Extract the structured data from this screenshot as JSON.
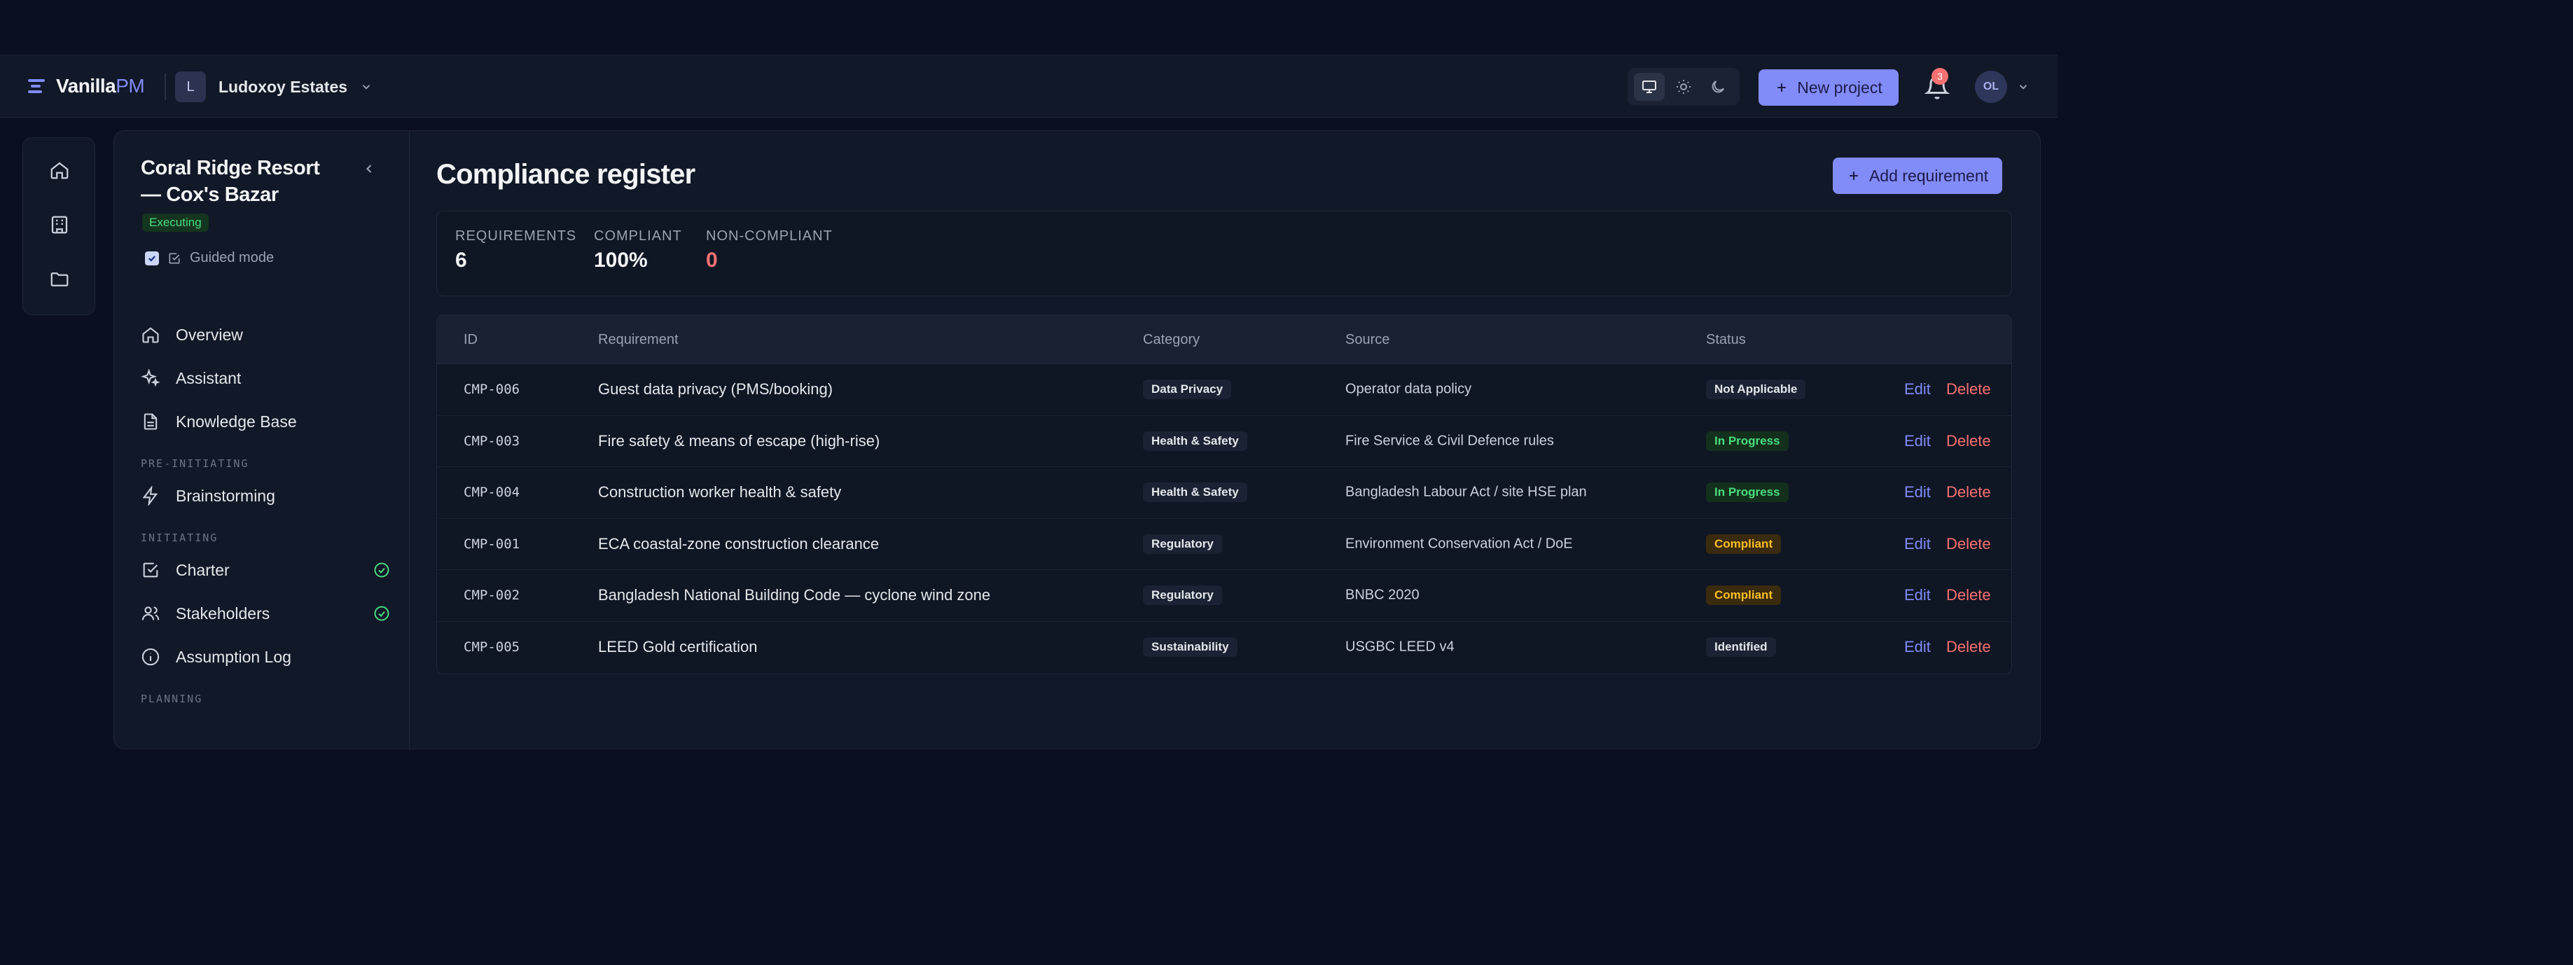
{
  "topbar": {
    "brand": {
      "name": "Vanilla",
      "suffix": "PM"
    },
    "org": {
      "initial": "L",
      "name": "Ludoxoy Estates"
    },
    "new_project_label": "New project",
    "notifications_count": "3",
    "user_initials": "OL"
  },
  "sidebar": {
    "project_title": "Coral Ridge Resort — Cox's Bazar",
    "status": "Executing",
    "guided_mode_label": "Guided mode",
    "items": [
      {
        "label": "Overview",
        "icon": "home-icon"
      },
      {
        "label": "Assistant",
        "icon": "sparkle-icon"
      },
      {
        "label": "Knowledge Base",
        "icon": "document-icon"
      }
    ],
    "sections": [
      {
        "title": "PRE-INITIATING",
        "items": [
          {
            "label": "Brainstorming",
            "icon": "bolt-icon"
          }
        ]
      },
      {
        "title": "INITIATING",
        "items": [
          {
            "label": "Charter",
            "icon": "checkbox-icon",
            "done": true
          },
          {
            "label": "Stakeholders",
            "icon": "users-icon",
            "done": true
          },
          {
            "label": "Assumption Log",
            "icon": "info-icon"
          }
        ]
      },
      {
        "title": "PLANNING",
        "items": []
      }
    ]
  },
  "main": {
    "title": "Compliance register",
    "add_button_label": "Add requirement",
    "stats": [
      {
        "label": "REQUIREMENTS",
        "value": "6"
      },
      {
        "label": "COMPLIANT",
        "value": "100%"
      },
      {
        "label": "NON-COMPLIANT",
        "value": "0"
      }
    ],
    "table": {
      "columns": [
        "ID",
        "Requirement",
        "Category",
        "Source",
        "Status"
      ],
      "rows": [
        {
          "id": "CMP-006",
          "requirement": "Guest data privacy (PMS/booking)",
          "category": "Data Privacy",
          "source": "Operator data policy",
          "status": "Not Applicable"
        },
        {
          "id": "CMP-003",
          "requirement": "Fire safety & means of escape (high-rise)",
          "category": "Health & Safety",
          "source": "Fire Service & Civil Defence rules",
          "status": "In Progress"
        },
        {
          "id": "CMP-004",
          "requirement": "Construction worker health & safety",
          "category": "Health & Safety",
          "source": "Bangladesh Labour Act / site HSE plan",
          "status": "In Progress"
        },
        {
          "id": "CMP-001",
          "requirement": "ECA coastal-zone construction clearance",
          "category": "Regulatory",
          "source": "Environment Conservation Act / DoE",
          "status": "Compliant"
        },
        {
          "id": "CMP-002",
          "requirement": "Bangladesh National Building Code — cyclone wind zone",
          "category": "Regulatory",
          "source": "BNBC 2020",
          "status": "Compliant"
        },
        {
          "id": "CMP-005",
          "requirement": "LEED Gold certification",
          "category": "Sustainability",
          "source": "USGBC LEED v4",
          "status": "Identified"
        }
      ],
      "edit_label": "Edit",
      "delete_label": "Delete"
    }
  },
  "colors": {
    "accent": "#818cf8",
    "danger": "#f87171",
    "success": "#4ade80",
    "warning": "#fbbf24",
    "background": "#0b1020",
    "surface": "#111827"
  }
}
